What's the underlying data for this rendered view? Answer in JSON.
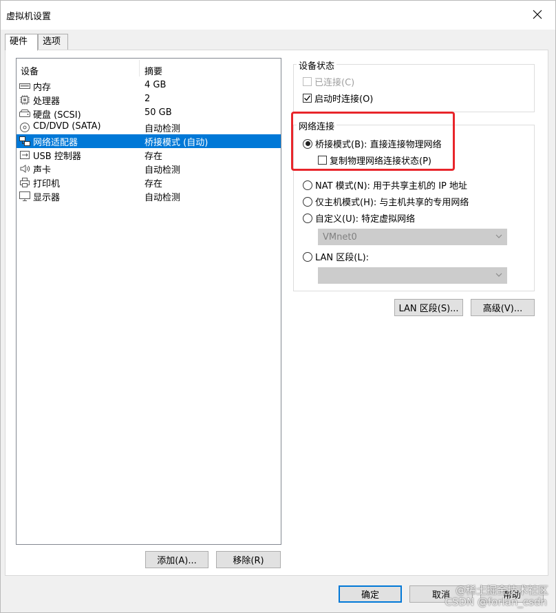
{
  "window": {
    "title": "虚拟机设置"
  },
  "tabs": [
    {
      "label": "硬件",
      "active": true
    },
    {
      "label": "选项",
      "active": false
    }
  ],
  "device_list": {
    "columns": [
      "设备",
      "摘要"
    ],
    "rows": [
      {
        "icon": "memory-icon",
        "name": "内存",
        "summary": "4 GB"
      },
      {
        "icon": "processor-icon",
        "name": "处理器",
        "summary": "2"
      },
      {
        "icon": "hard-disk-icon",
        "name": "硬盘 (SCSI)",
        "summary": "50 GB"
      },
      {
        "icon": "cd-dvd-icon",
        "name": "CD/DVD (SATA)",
        "summary": "自动检测"
      },
      {
        "icon": "network-adapter-icon",
        "name": "网络适配器",
        "summary": "桥接模式 (自动)",
        "selected": true
      },
      {
        "icon": "usb-icon",
        "name": "USB 控制器",
        "summary": "存在"
      },
      {
        "icon": "sound-icon",
        "name": "声卡",
        "summary": "自动检测"
      },
      {
        "icon": "printer-icon",
        "name": "打印机",
        "summary": "存在"
      },
      {
        "icon": "display-icon",
        "name": "显示器",
        "summary": "自动检测"
      }
    ],
    "add_button": "添加(A)...",
    "remove_button": "移除(R)"
  },
  "device_status": {
    "label": "设备状态",
    "connected": {
      "label": "已连接(C)",
      "checked": false,
      "disabled": true
    },
    "connect_at_power_on": {
      "label": "启动时连接(O)",
      "checked": true
    }
  },
  "network_connection": {
    "label": "网络连接",
    "bridged": {
      "label": "桥接模式(B): 直接连接物理网络",
      "selected": true
    },
    "replicate": {
      "label": "复制物理网络连接状态(P)",
      "checked": false
    },
    "nat": {
      "label": "NAT 模式(N): 用于共享主机的 IP 地址",
      "selected": false
    },
    "host_only": {
      "label": "仅主机模式(H): 与主机共享的专用网络",
      "selected": false
    },
    "custom": {
      "label": "自定义(U): 特定虚拟网络",
      "selected": false
    },
    "custom_network": "VMnet0",
    "lan_segment": {
      "label": "LAN 区段(L):",
      "selected": false
    },
    "lan_segment_value": ""
  },
  "buttons": {
    "lan_segments": "LAN 区段(S)...",
    "advanced": "高级(V)...",
    "ok": "确定",
    "cancel": "取消",
    "help": "帮助"
  },
  "watermark": {
    "line1": "@稀土掘金技术社区",
    "line2": "CSDN @forlan_csdn"
  },
  "colors": {
    "selection": "#0078d7",
    "highlight_box": "#e8252a"
  }
}
